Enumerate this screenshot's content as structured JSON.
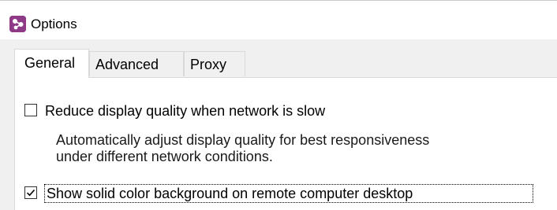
{
  "window": {
    "title": "Options",
    "icon": "app-logo-icon",
    "accent_color": "#8e3a86"
  },
  "tabs": [
    {
      "label": "General",
      "active": true
    },
    {
      "label": "Advanced",
      "active": false
    },
    {
      "label": "Proxy",
      "active": false
    }
  ],
  "general": {
    "reduce_quality": {
      "label": "Reduce display quality when network is slow",
      "checked": false
    },
    "description": {
      "line1": "Automatically adjust display quality for best responsiveness",
      "line2": "under different network conditions."
    },
    "solid_background": {
      "label": "Show solid color background on remote computer desktop",
      "checked": true
    }
  }
}
